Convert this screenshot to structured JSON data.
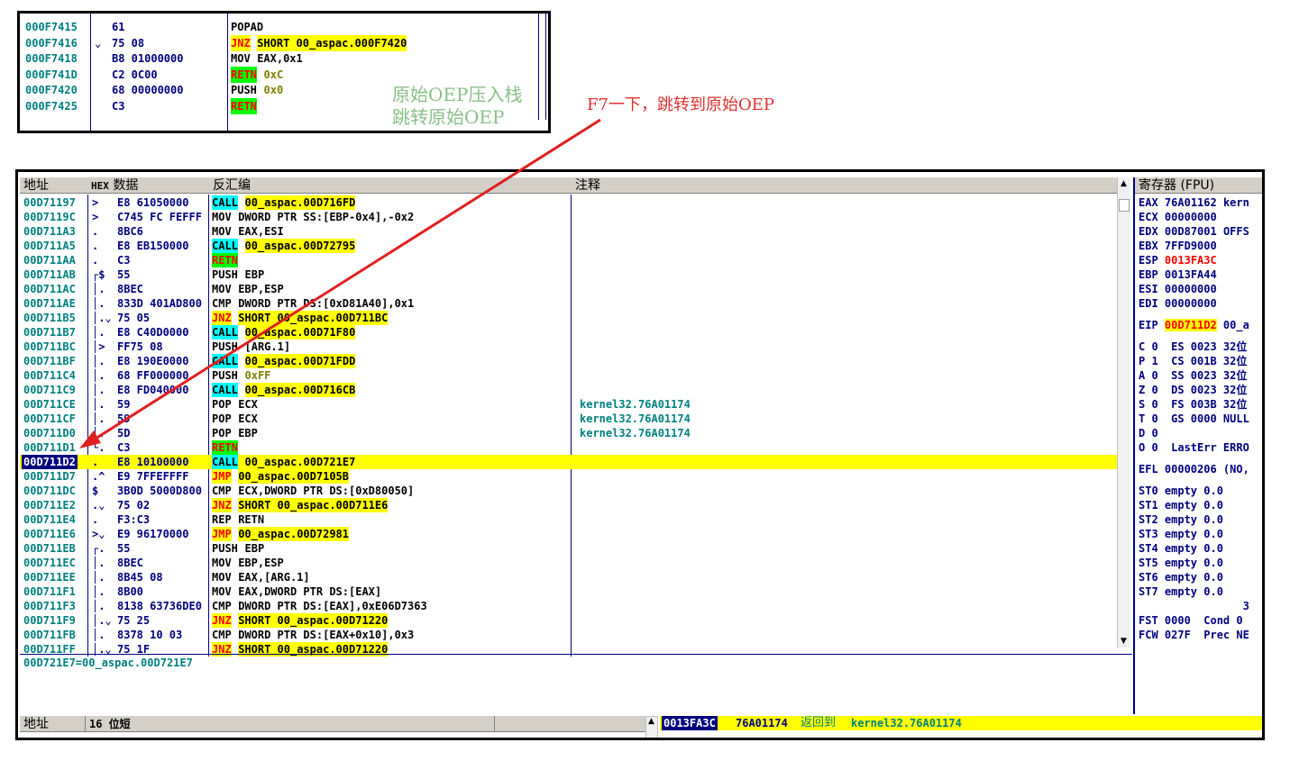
{
  "top_panel": {
    "rows": [
      {
        "addr": "000F7415",
        "mark": "",
        "hex": "61",
        "mnem": "POPAD",
        "mnem_style": "plain",
        "ops": "",
        "ops_style": "plain"
      },
      {
        "addr": "000F7416",
        "mark": "⌄",
        "hex": "75 08",
        "mnem": "JNZ",
        "mnem_style": "yellow-red",
        "ops": "SHORT 00_aspac.000F7420",
        "ops_style": "yellow"
      },
      {
        "addr": "000F7418",
        "mark": "",
        "hex": "B8 01000000",
        "mnem": "MOV",
        "mnem_style": "plain",
        "ops": "EAX,0x1",
        "ops_style": "plain"
      },
      {
        "addr": "000F741D",
        "mark": "",
        "hex": "C2 0C00",
        "mnem": "RETN",
        "mnem_style": "green",
        "ops": "0xC",
        "ops_style": "olive"
      },
      {
        "addr": "000F7420",
        "mark": "",
        "hex": "68 00000000",
        "mnem": "PUSH",
        "mnem_style": "plain",
        "ops": "0x0",
        "ops_style": "olive"
      },
      {
        "addr": "000F7425",
        "mark": "",
        "hex": "C3",
        "mnem": "RETN",
        "mnem_style": "green",
        "ops": "",
        "ops_style": "plain"
      }
    ],
    "note": "原始OEP压入栈\n跳转原始OEP"
  },
  "annotation": "F7一下，跳转到原始OEP",
  "cpu": {
    "headers": {
      "addr": "地址",
      "hex_bold": "HEX",
      "hex": " 数据",
      "disasm": "反汇编",
      "comment": "注释"
    },
    "rows": [
      {
        "addr": "00D71197",
        "mark": ">",
        "hex": "E8 61050000",
        "mnem": "CALL",
        "mnem_style": "cyan",
        "ops": "00_aspac.00D716FD",
        "ops_style": "yellow",
        "comment": ""
      },
      {
        "addr": "00D7119C",
        "mark": ">",
        "hex": "C745 FC FEFFF",
        "mnem": "MOV",
        "mnem_style": "plain",
        "ops": "DWORD PTR SS:[EBP-0x4],-0x2",
        "ops_style": "plain",
        "comment": ""
      },
      {
        "addr": "00D711A3",
        "mark": ".",
        "hex": "8BC6",
        "mnem": "MOV",
        "mnem_style": "plain",
        "ops": "EAX,ESI",
        "ops_style": "plain",
        "comment": ""
      },
      {
        "addr": "00D711A5",
        "mark": ".",
        "hex": "E8 EB150000",
        "mnem": "CALL",
        "mnem_style": "cyan",
        "ops": "00_aspac.00D72795",
        "ops_style": "yellow",
        "comment": ""
      },
      {
        "addr": "00D711AA",
        "mark": ".",
        "hex": "C3",
        "mnem": "RETN",
        "mnem_style": "green",
        "ops": "",
        "ops_style": "plain",
        "comment": ""
      },
      {
        "addr": "00D711AB",
        "mark": "┌$",
        "hex": "55",
        "mnem": "PUSH",
        "mnem_style": "plain",
        "ops": "EBP",
        "ops_style": "plain",
        "comment": ""
      },
      {
        "addr": "00D711AC",
        "mark": "│.",
        "hex": "8BEC",
        "mnem": "MOV",
        "mnem_style": "plain",
        "ops": "EBP,ESP",
        "ops_style": "plain",
        "comment": ""
      },
      {
        "addr": "00D711AE",
        "mark": "│.",
        "hex": "833D 401AD800",
        "mnem": "CMP",
        "mnem_style": "plain",
        "ops": "DWORD PTR DS:[0xD81A40],0x1",
        "ops_style": "plain",
        "comment": ""
      },
      {
        "addr": "00D711B5",
        "mark": "│.⌄",
        "hex": "75 05",
        "mnem": "JNZ",
        "mnem_style": "yellow-red",
        "ops": "SHORT 00_aspac.00D711BC",
        "ops_style": "yellow",
        "comment": ""
      },
      {
        "addr": "00D711B7",
        "mark": "│.",
        "hex": "E8 C40D0000",
        "mnem": "CALL",
        "mnem_style": "cyan",
        "ops": "00_aspac.00D71F80",
        "ops_style": "yellow",
        "comment": ""
      },
      {
        "addr": "00D711BC",
        "mark": "│>",
        "hex": "FF75 08",
        "mnem": "PUSH",
        "mnem_style": "plain",
        "ops": "[ARG.1]",
        "ops_style": "plain",
        "comment": ""
      },
      {
        "addr": "00D711BF",
        "mark": "│.",
        "hex": "E8 190E0000",
        "mnem": "CALL",
        "mnem_style": "cyan",
        "ops": "00_aspac.00D71FDD",
        "ops_style": "yellow",
        "comment": ""
      },
      {
        "addr": "00D711C4",
        "mark": "│.",
        "hex": "68 FF000000",
        "mnem": "PUSH",
        "mnem_style": "plain",
        "ops": "0xFF",
        "ops_style": "olive",
        "comment": ""
      },
      {
        "addr": "00D711C9",
        "mark": "│.",
        "hex": "E8 FD040000",
        "mnem": "CALL",
        "mnem_style": "cyan",
        "ops": "00_aspac.00D716CB",
        "ops_style": "yellow",
        "comment": ""
      },
      {
        "addr": "00D711CE",
        "mark": "│.",
        "hex": "59",
        "mnem": "POP",
        "mnem_style": "plain",
        "ops": "ECX",
        "ops_style": "plain",
        "comment": "kernel32.76A01174"
      },
      {
        "addr": "00D711CF",
        "mark": "│.",
        "hex": "59",
        "mnem": "POP",
        "mnem_style": "plain",
        "ops": "ECX",
        "ops_style": "plain",
        "comment": "kernel32.76A01174"
      },
      {
        "addr": "00D711D0",
        "mark": "│.",
        "hex": "5D",
        "mnem": "POP",
        "mnem_style": "plain",
        "ops": "EBP",
        "ops_style": "plain",
        "comment": "kernel32.76A01174"
      },
      {
        "addr": "00D711D1",
        "mark": "└.",
        "hex": "C3",
        "mnem": "RETN",
        "mnem_style": "green",
        "ops": "",
        "ops_style": "plain",
        "comment": ""
      },
      {
        "addr": "00D711D2",
        "mark": ".",
        "hex": "E8 10100000",
        "mnem": "CALL",
        "mnem_style": "cyan",
        "ops": "00_aspac.00D721E7",
        "ops_style": "plain",
        "comment": "",
        "selected": true
      },
      {
        "addr": "00D711D7",
        "mark": ".^",
        "hex": "E9 7FFEFFFF",
        "mnem": "JMP",
        "mnem_style": "yellow-red",
        "ops": "00_aspac.00D7105B",
        "ops_style": "yellow",
        "comment": ""
      },
      {
        "addr": "00D711DC",
        "mark": "$",
        "hex": "3B0D 5000D800",
        "mnem": "CMP",
        "mnem_style": "plain",
        "ops": "ECX,DWORD PTR DS:[0xD80050]",
        "ops_style": "plain",
        "comment": ""
      },
      {
        "addr": "00D711E2",
        "mark": ".⌄",
        "hex": "75 02",
        "mnem": "JNZ",
        "mnem_style": "yellow-red",
        "ops": "SHORT 00_aspac.00D711E6",
        "ops_style": "yellow",
        "comment": ""
      },
      {
        "addr": "00D711E4",
        "mark": ".",
        "hex": "F3:C3",
        "mnem": "REP",
        "mnem_style": "plain",
        "ops": "RETN",
        "ops_style": "plain",
        "comment": ""
      },
      {
        "addr": "00D711E6",
        "mark": ">⌄",
        "hex": "E9 96170000",
        "mnem": "JMP",
        "mnem_style": "yellow-red",
        "ops": "00_aspac.00D72981",
        "ops_style": "yellow",
        "comment": ""
      },
      {
        "addr": "00D711EB",
        "mark": "┌.",
        "hex": "55",
        "mnem": "PUSH",
        "mnem_style": "plain",
        "ops": "EBP",
        "ops_style": "plain",
        "comment": ""
      },
      {
        "addr": "00D711EC",
        "mark": "│.",
        "hex": "8BEC",
        "mnem": "MOV",
        "mnem_style": "plain",
        "ops": "EBP,ESP",
        "ops_style": "plain",
        "comment": ""
      },
      {
        "addr": "00D711EE",
        "mark": "│.",
        "hex": "8B45 08",
        "mnem": "MOV",
        "mnem_style": "plain",
        "ops": "EAX,[ARG.1]",
        "ops_style": "plain",
        "comment": ""
      },
      {
        "addr": "00D711F1",
        "mark": "│.",
        "hex": "8B00",
        "mnem": "MOV",
        "mnem_style": "plain",
        "ops": "EAX,DWORD PTR DS:[EAX]",
        "ops_style": "plain",
        "comment": ""
      },
      {
        "addr": "00D711F3",
        "mark": "│.",
        "hex": "8138 63736DE0",
        "mnem": "CMP",
        "mnem_style": "plain",
        "ops": "DWORD PTR DS:[EAX],0xE06D7363",
        "ops_style": "plain",
        "comment": ""
      },
      {
        "addr": "00D711F9",
        "mark": "│.⌄",
        "hex": "75 25",
        "mnem": "JNZ",
        "mnem_style": "yellow-red",
        "ops": "SHORT 00_aspac.00D71220",
        "ops_style": "yellow",
        "comment": ""
      },
      {
        "addr": "00D711FB",
        "mark": "│.",
        "hex": "8378 10 03",
        "mnem": "CMP",
        "mnem_style": "plain",
        "ops": "DWORD PTR DS:[EAX+0x10],0x3",
        "ops_style": "plain",
        "comment": ""
      },
      {
        "addr": "00D711FF",
        "mark": "│.⌄",
        "hex": "75 1F",
        "mnem": "JNZ",
        "mnem_style": "yellow-red",
        "ops": "SHORT 00_aspac.00D71220",
        "ops_style": "yellow",
        "comment": ""
      }
    ],
    "info_line": "00D721E7=00_aspac.00D721E7"
  },
  "registers": {
    "header": "寄存器 (FPU)",
    "gp": [
      {
        "n": "EAX",
        "v": "76A01162",
        "c": "kern",
        "red": false
      },
      {
        "n": "ECX",
        "v": "00000000",
        "c": "",
        "red": false
      },
      {
        "n": "EDX",
        "v": "00D87001",
        "c": "OFFS",
        "red": false
      },
      {
        "n": "EBX",
        "v": "7FFD9000",
        "c": "",
        "red": false
      },
      {
        "n": "ESP",
        "v": "0013FA3C",
        "c": "",
        "red": true
      },
      {
        "n": "EBP",
        "v": "0013FA44",
        "c": "",
        "red": false
      },
      {
        "n": "ESI",
        "v": "00000000",
        "c": "",
        "red": false
      },
      {
        "n": "EDI",
        "v": "00000000",
        "c": "",
        "red": false
      }
    ],
    "eip": {
      "n": "EIP",
      "v": "00D711D2",
      "c": "00_a"
    },
    "flags": [
      "C 0  ES 0023 32位",
      "P 1  CS 001B 32位",
      "A 0  SS 0023 32位",
      "Z 0  DS 0023 32位",
      "S 0  FS 003B 32位",
      "T 0  GS 0000 NULL",
      "D 0",
      "O 0  LastErr ERRO"
    ],
    "efl": "EFL 00000206 (NO,",
    "fpu": [
      "ST0 empty 0.0",
      "ST1 empty 0.0",
      "ST2 empty 0.0",
      "ST3 empty 0.0",
      "ST4 empty 0.0",
      "ST5 empty 0.0",
      "ST6 empty 0.0",
      "ST7 empty 0.0"
    ],
    "fpu_extra": "3",
    "fst": "FST 0000  Cond 0",
    "fcw": "FCW 027F  Prec NE"
  },
  "dump": {
    "addr_header": "地址",
    "mode_header": "16 位短"
  },
  "stack": {
    "addr": "0013FA3C",
    "val": "76A01174",
    "cn": "返回到",
    "comment": "kernel32.76A01174"
  }
}
